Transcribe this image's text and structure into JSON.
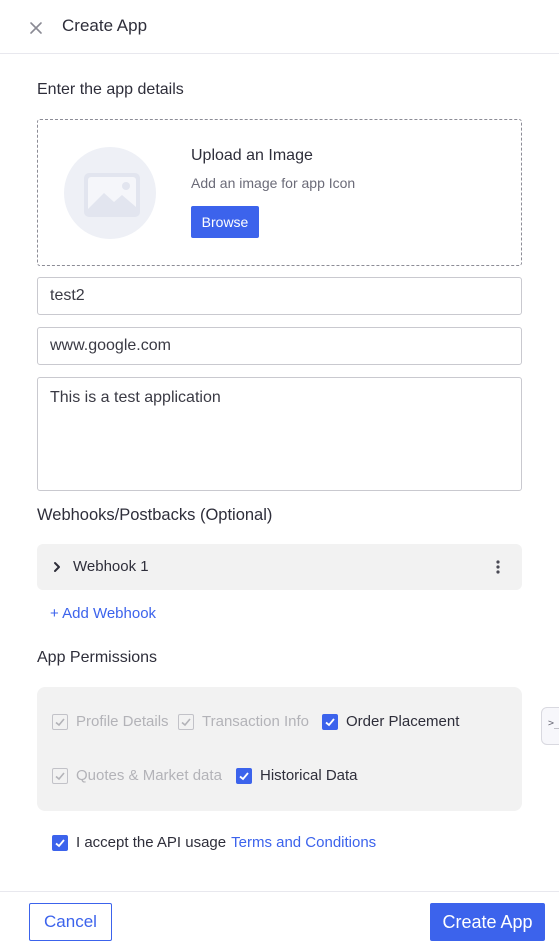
{
  "header": {
    "title": "Create App",
    "close_icon": "close-icon"
  },
  "details": {
    "section_title": "Enter the app details",
    "upload": {
      "icon": "image-placeholder-icon",
      "title": "Upload an Image",
      "subtitle": "Add an image for app Icon",
      "browse_label": "Browse"
    },
    "fields": {
      "app_name": "test2",
      "redirect_url": "www.google.com",
      "description": "This is a test application"
    }
  },
  "webhooks": {
    "section_title": "Webhooks/Postbacks (Optional)",
    "items": [
      {
        "label": "Webhook 1"
      }
    ],
    "add_label": "+ Add Webhook"
  },
  "permissions": {
    "section_title": "App Permissions",
    "items": [
      {
        "label": "Profile Details",
        "checked": true,
        "disabled": true
      },
      {
        "label": "Transaction Info",
        "checked": true,
        "disabled": true
      },
      {
        "label": "Order Placement",
        "checked": true,
        "disabled": false
      },
      {
        "label": "Quotes & Market data",
        "checked": true,
        "disabled": true
      },
      {
        "label": "Historical Data",
        "checked": true,
        "disabled": false
      }
    ]
  },
  "side_tab": {
    "label": ">_"
  },
  "terms": {
    "checked": true,
    "text": "I accept the API usage",
    "link": "Terms and Conditions"
  },
  "footer": {
    "cancel_label": "Cancel",
    "create_label": "Create App"
  },
  "colors": {
    "accent": "#3c63ec",
    "panel_bg": "#f2f2f2",
    "disabled_text": "#b3b3b8"
  }
}
